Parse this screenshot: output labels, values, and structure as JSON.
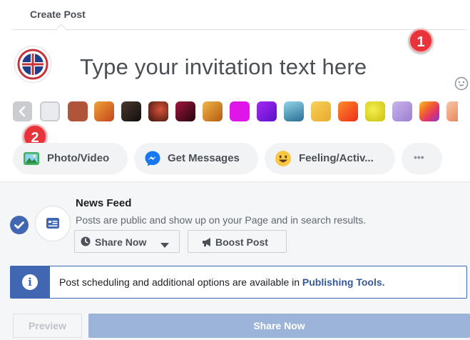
{
  "header": {
    "title": "Create Post"
  },
  "composer": {
    "placeholder": "Type your invitation text here"
  },
  "annotations": {
    "badge_1": "1",
    "badge_2": "2"
  },
  "backgrounds": {
    "prev_icon": "chevron-left-icon",
    "swatches": [
      {
        "name": "white",
        "color": "#e9ebee"
      },
      {
        "name": "rust",
        "color": "#b0553a"
      },
      {
        "name": "autumn-leaves",
        "color": "#e27a1e"
      },
      {
        "name": "dark-coffee",
        "color": "#2b2320"
      },
      {
        "name": "dark-fruit",
        "color": "#6b2318"
      },
      {
        "name": "crimson-dark",
        "color": "#5b0d25"
      },
      {
        "name": "golden-floral",
        "color": "#d7851c"
      },
      {
        "name": "magenta",
        "color": "#e016e8"
      },
      {
        "name": "violet",
        "color": "#7c13d9"
      },
      {
        "name": "teal-landscape",
        "color": "#3f8fb3"
      },
      {
        "name": "yellow-pattern",
        "color": "#f3c243"
      },
      {
        "name": "orange-red",
        "color": "#f4501d"
      },
      {
        "name": "yellow-lime",
        "color": "#e6e212"
      },
      {
        "name": "lavender-pattern",
        "color": "#b39ad8"
      },
      {
        "name": "rainbow-stripes",
        "color": "#e24a6b"
      },
      {
        "name": "peach-pattern",
        "color": "#f2a884"
      }
    ]
  },
  "actions": [
    {
      "label": "Photo/Video",
      "icon": "photo-icon"
    },
    {
      "label": "Get Messages",
      "icon": "messenger-icon"
    },
    {
      "label": "Feeling/Activ...",
      "icon": "smiley-icon"
    },
    {
      "label": "•••",
      "icon": "more-icon"
    }
  ],
  "newsfeed": {
    "title": "News Feed",
    "description": "Posts are public and show up on your Page and in search results.",
    "share_now_label": "Share Now",
    "boost_label": "Boost Post"
  },
  "info": {
    "text": "Post scheduling and additional options are available in ",
    "link": "Publishing Tools."
  },
  "footer": {
    "preview_label": "Preview",
    "share_now_label": "Share Now"
  },
  "colors": {
    "accent": "#4267b2",
    "badge": "#e8333a",
    "disabled_primary": "#9cb4d8"
  }
}
